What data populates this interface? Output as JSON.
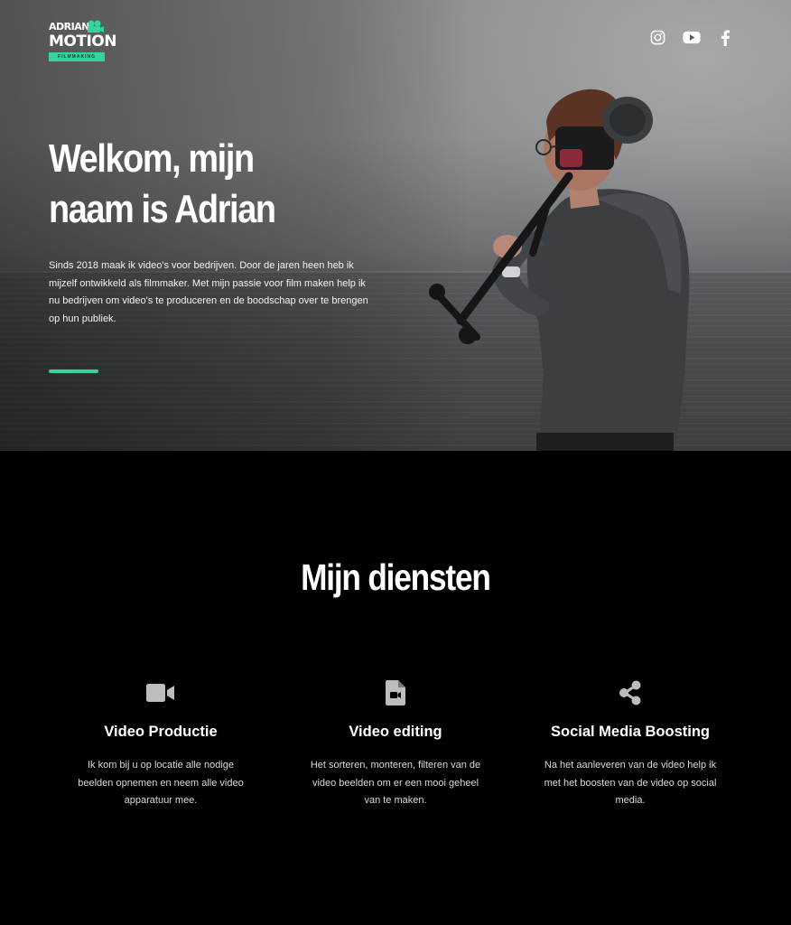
{
  "logo": {
    "line1": "ADRIAN",
    "line2": "MOTION",
    "tagline": "FILMMAKING",
    "icon": "film-camera-icon",
    "accent_color": "#2fd6a0"
  },
  "social": {
    "instagram": "instagram-icon",
    "youtube": "youtube-icon",
    "facebook": "facebook-icon"
  },
  "hero": {
    "title": "Welkom, mijn naam is Adrian",
    "text": "Sinds 2018 maak ik video's voor bedrijven. Door de jaren heen heb ik mijzelf ontwikkeld als filmmaker. Met mijn passie voor film maken help ik nu bedrijven om video's te produceren en de boodschap over te brengen op hun publiek."
  },
  "services": {
    "title": "Mijn diensten",
    "items": [
      {
        "icon": "video-camera-icon",
        "title": "Video Productie",
        "text": "Ik kom bij u op locatie alle nodige beelden opnemen en neem alle video apparatuur mee."
      },
      {
        "icon": "file-video-icon",
        "title": "Video editing",
        "text": "Het sorteren, monteren, filteren van de video beelden om er een mooi geheel van te maken."
      },
      {
        "icon": "share-icon",
        "title": "Social Media Boosting",
        "text": "Na het aanleveren van de video help ik met het boosten van de video op social media."
      }
    ]
  }
}
